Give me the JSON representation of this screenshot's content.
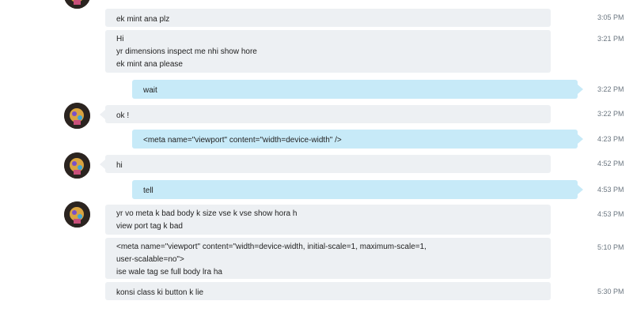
{
  "messages": [
    {
      "lines": [
        "ek mint ana plz"
      ],
      "time": "3:05 PM"
    },
    {
      "lines": [
        "Hi",
        "yr dimensions inspect me nhi show hore",
        "ek mint ana please"
      ],
      "time": "3:21 PM"
    },
    {
      "lines": [
        "wait"
      ],
      "time": "3:22 PM"
    },
    {
      "lines": [
        "ok !"
      ],
      "time": "3:22 PM"
    },
    {
      "lines": [
        "<meta name=\"viewport\" content=\"width=device-width\" />"
      ],
      "time": "4:23 PM"
    },
    {
      "lines": [
        "hi"
      ],
      "time": "4:52 PM"
    },
    {
      "lines": [
        "tell"
      ],
      "time": "4:53 PM"
    },
    {
      "lines": [
        "yr vo meta k bad body k size vse k vse show hora h",
        "view port tag k bad"
      ],
      "time": "4:53 PM"
    },
    {
      "lines": [
        "<meta name=\"viewport\" content=\"width=device-width, initial-scale=1, maximum-scale=1,",
        "user-scalable=no\">",
        "ise wale tag se full body lra ha"
      ],
      "time": "5:10 PM"
    },
    {
      "lines": [
        "konsi class ki button k lie"
      ],
      "time": "5:30 PM"
    }
  ],
  "avatar_icon": "user-avatar-icon",
  "colors": {
    "incoming": "#edf0f3",
    "outgoing": "#c7eaf8",
    "timestamp": "#6b7680"
  }
}
